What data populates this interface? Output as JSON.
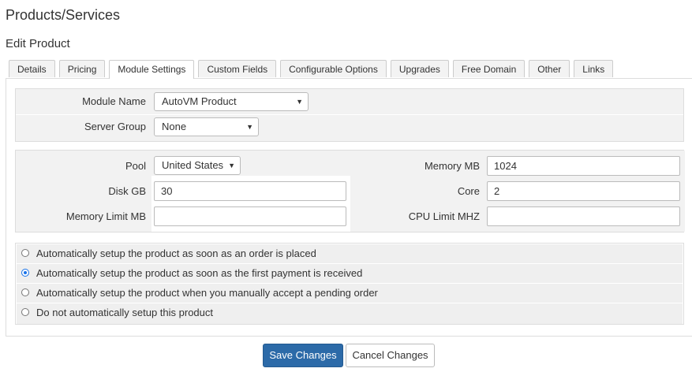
{
  "header": {
    "title": "Products/Services",
    "subtitle": "Edit Product"
  },
  "tabs": [
    {
      "label": "Details"
    },
    {
      "label": "Pricing"
    },
    {
      "label": "Module Settings",
      "active": true
    },
    {
      "label": "Custom Fields"
    },
    {
      "label": "Configurable Options"
    },
    {
      "label": "Upgrades"
    },
    {
      "label": "Free Domain"
    },
    {
      "label": "Other"
    },
    {
      "label": "Links"
    }
  ],
  "module": {
    "module_name_label": "Module Name",
    "module_name_value": "AutoVM Product",
    "server_group_label": "Server Group",
    "server_group_value": "None"
  },
  "config": {
    "pool_label": "Pool",
    "pool_value": "United States",
    "disk_label": "Disk GB",
    "disk_value": "30",
    "memory_limit_label": "Memory Limit MB",
    "memory_limit_value": "",
    "memory_label": "Memory MB",
    "memory_value": "1024",
    "core_label": "Core",
    "core_value": "2",
    "cpu_limit_label": "CPU Limit MHZ",
    "cpu_limit_value": ""
  },
  "setup_options": [
    {
      "label": "Automatically setup the product as soon as an order is placed",
      "selected": false
    },
    {
      "label": "Automatically setup the product as soon as the first payment is received",
      "selected": true
    },
    {
      "label": "Automatically setup the product when you manually accept a pending order",
      "selected": false
    },
    {
      "label": "Do not automatically setup this product",
      "selected": false
    }
  ],
  "actions": {
    "save_label": "Save Changes",
    "cancel_label": "Cancel Changes"
  },
  "colors": {
    "primary": "#2c6aa8",
    "radio_selected": "#1a73e8",
    "panel_bg": "#f2f2f2"
  }
}
